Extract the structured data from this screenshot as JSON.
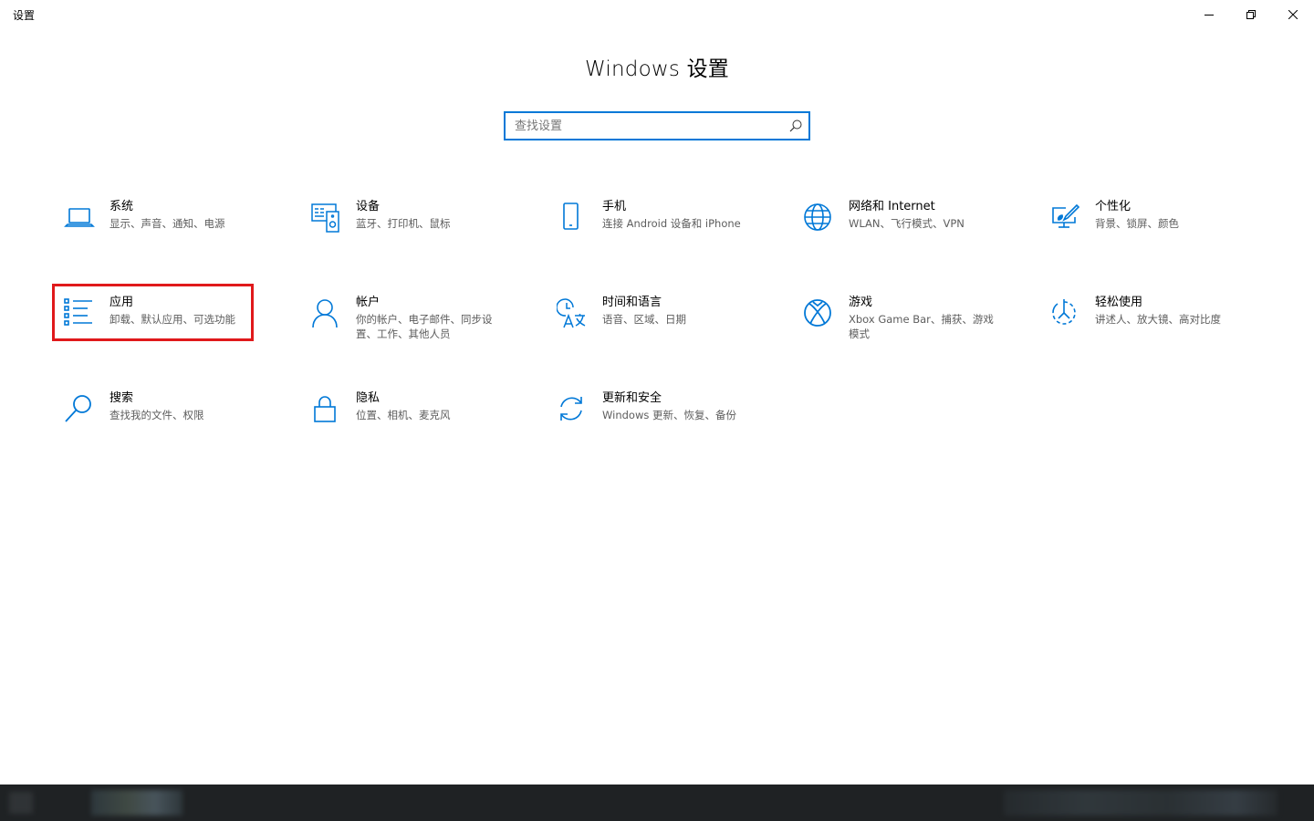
{
  "window": {
    "title": "设置",
    "controls": {
      "minimize": "minimize-icon",
      "restore": "restore-icon",
      "close": "close-icon"
    }
  },
  "header": {
    "title": "Windows 设置"
  },
  "search": {
    "placeholder": "查找设置",
    "value": "",
    "icon": "search-icon"
  },
  "colors": {
    "accent": "#0078d7",
    "highlight": "#e0191b",
    "desc_text": "#5d5d5d"
  },
  "tiles": [
    {
      "id": "system",
      "icon": "laptop-icon",
      "title": "系统",
      "desc": "显示、声音、通知、电源"
    },
    {
      "id": "devices",
      "icon": "devices-icon",
      "title": "设备",
      "desc": "蓝牙、打印机、鼠标"
    },
    {
      "id": "phone",
      "icon": "phone-icon",
      "title": "手机",
      "desc": "连接 Android 设备和 iPhone"
    },
    {
      "id": "network",
      "icon": "globe-icon",
      "title": "网络和 Internet",
      "desc": "WLAN、飞行模式、VPN"
    },
    {
      "id": "personalization",
      "icon": "brush-icon",
      "title": "个性化",
      "desc": "背景、锁屏、颜色"
    },
    {
      "id": "apps",
      "icon": "apps-list-icon",
      "title": "应用",
      "desc": "卸载、默认应用、可选功能"
    },
    {
      "id": "accounts",
      "icon": "person-icon",
      "title": "帐户",
      "desc": "你的帐户、电子邮件、同步设置、工作、其他人员"
    },
    {
      "id": "time-language",
      "icon": "time-language-icon",
      "title": "时间和语言",
      "desc": "语音、区域、日期"
    },
    {
      "id": "gaming",
      "icon": "xbox-icon",
      "title": "游戏",
      "desc": "Xbox Game Bar、捕获、游戏模式"
    },
    {
      "id": "ease-of-access",
      "icon": "ease-of-access-icon",
      "title": "轻松使用",
      "desc": "讲述人、放大镜、高对比度"
    },
    {
      "id": "search",
      "icon": "magnifier-icon",
      "title": "搜索",
      "desc": "查找我的文件、权限"
    },
    {
      "id": "privacy",
      "icon": "lock-icon",
      "title": "隐私",
      "desc": "位置、相机、麦克风"
    },
    {
      "id": "update-security",
      "icon": "sync-icon",
      "title": "更新和安全",
      "desc": "Windows 更新、恢复、备份"
    }
  ]
}
